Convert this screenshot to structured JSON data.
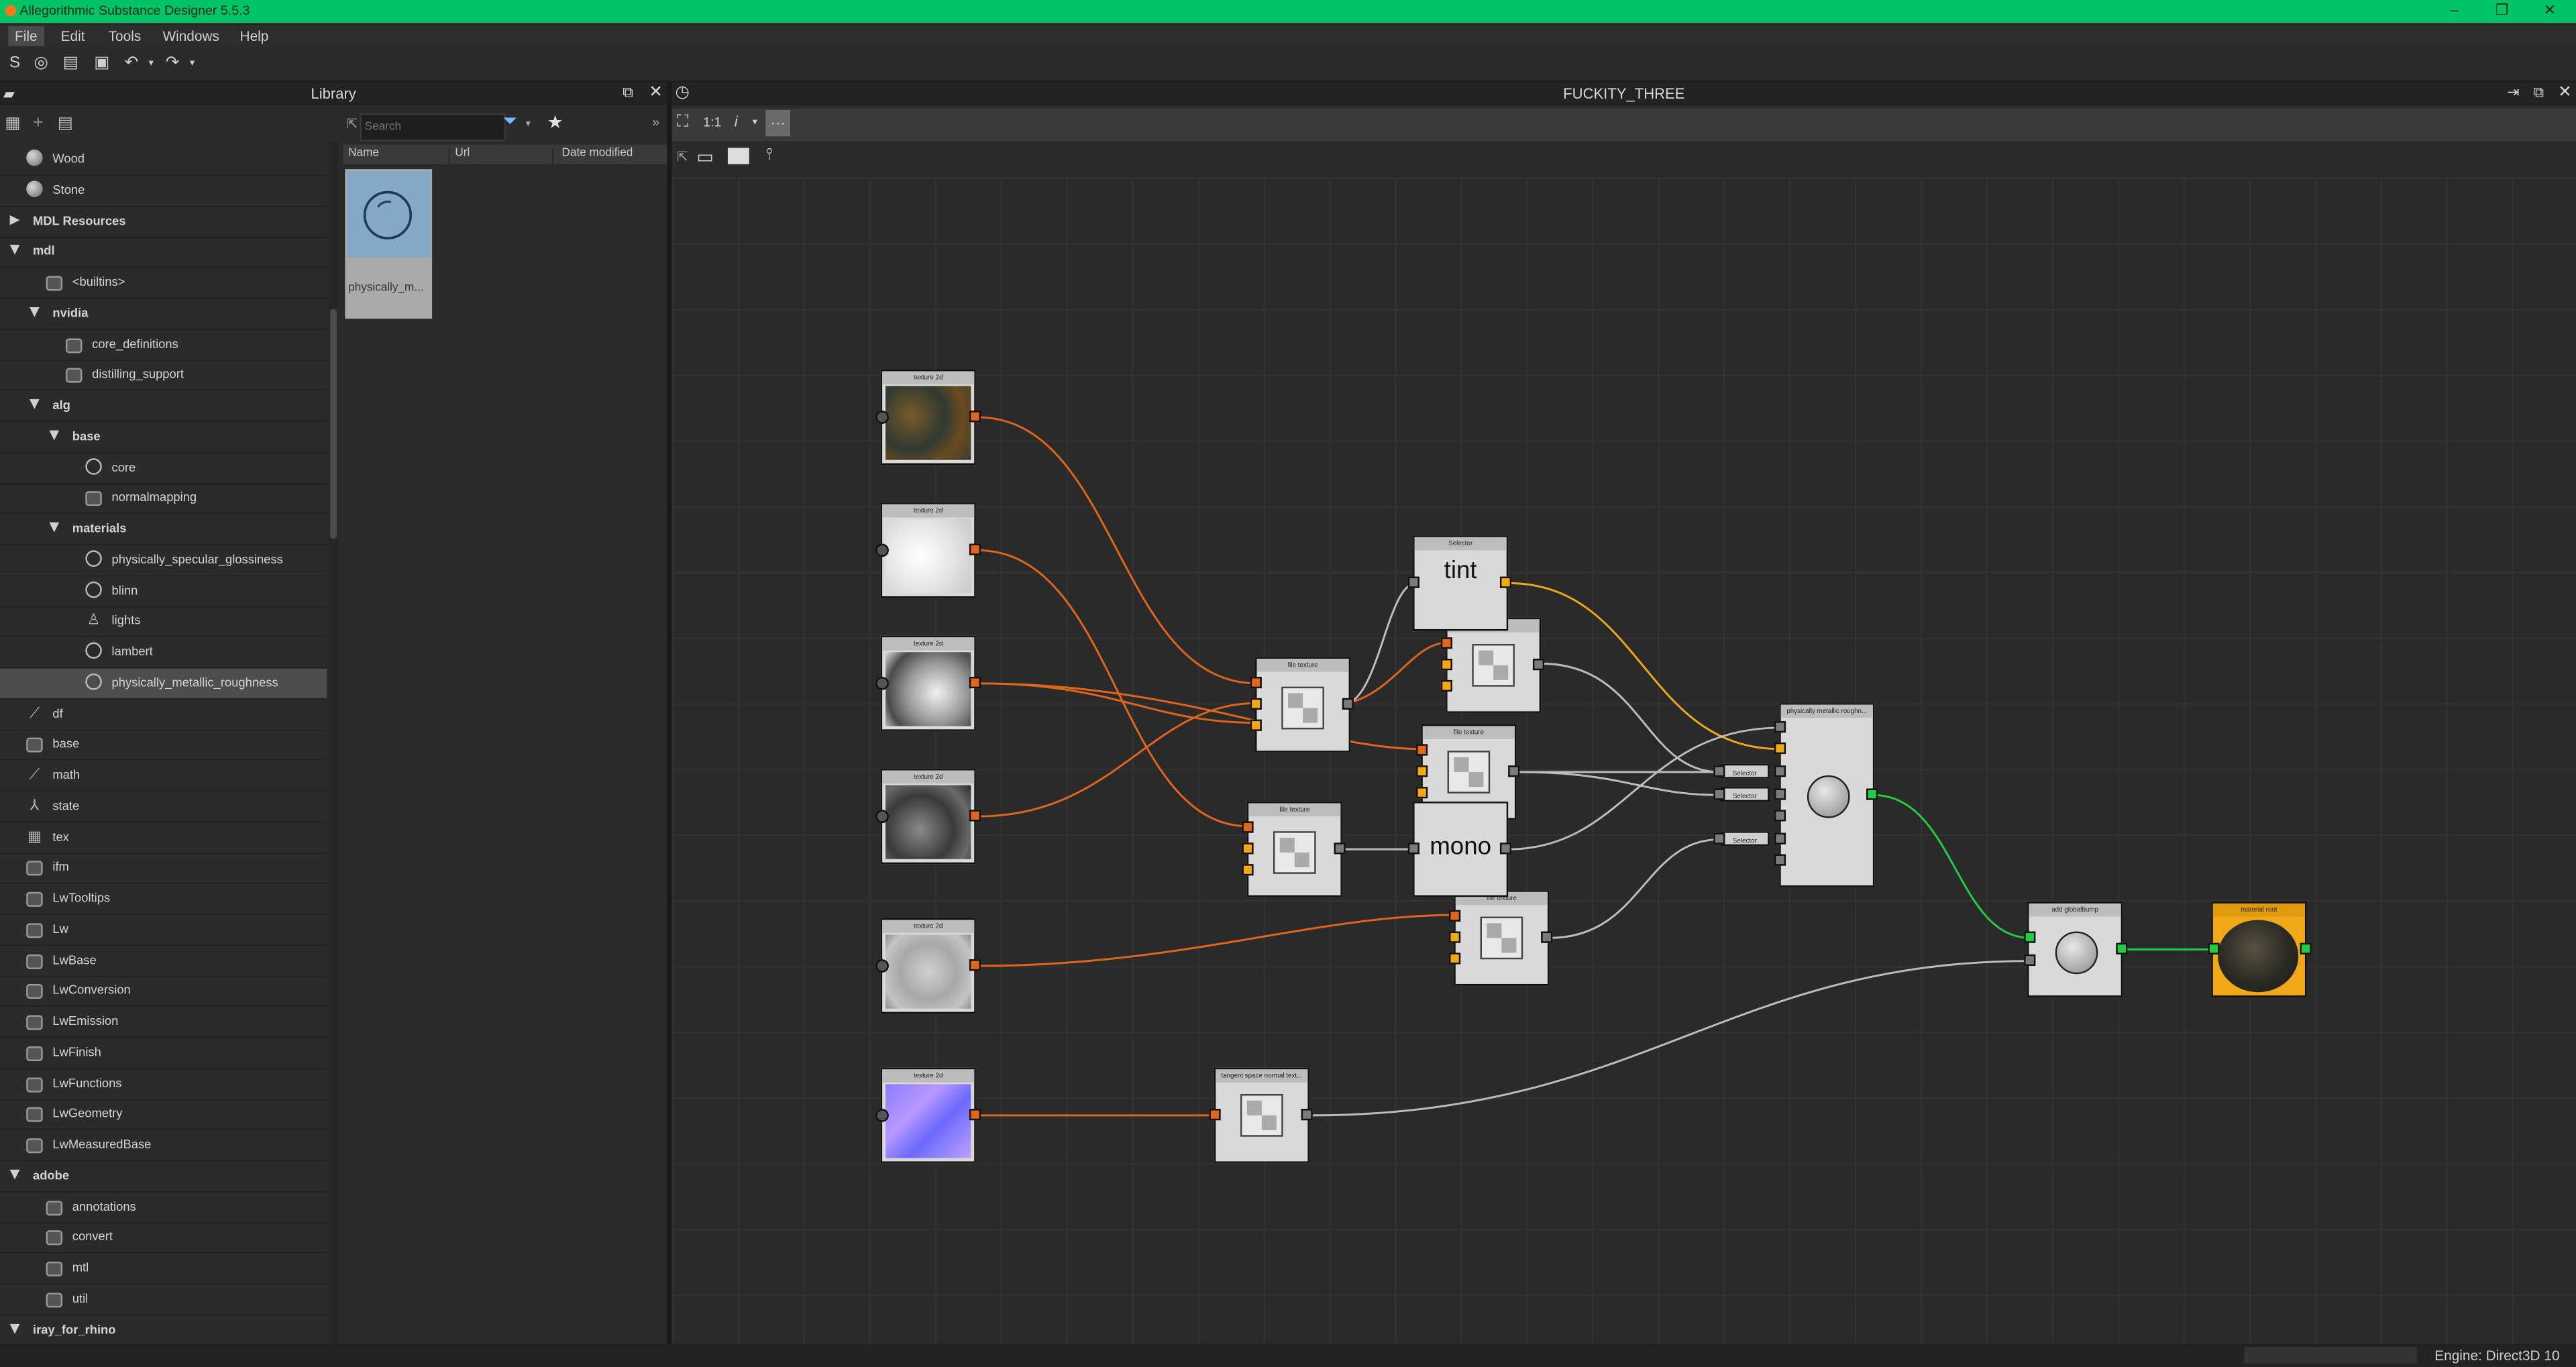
{
  "window": {
    "title": "Allegorithmic Substance Designer 5.5.3",
    "min": "–",
    "max": "❐",
    "close": "✕"
  },
  "menu": [
    "File",
    "Edit",
    "Tools",
    "Windows",
    "Help"
  ],
  "library": {
    "title": "Library",
    "search_placeholder": "Search",
    "columns": [
      "Name",
      "Url",
      "Date modified"
    ],
    "thumb_label": "physically_m...",
    "tree": [
      {
        "label": "Wood",
        "indent": 0,
        "icon": "ball"
      },
      {
        "label": "Stone",
        "indent": 0,
        "icon": "ball"
      },
      {
        "label": "MDL Resources",
        "indent": 0,
        "toggle": "right",
        "bold": true
      },
      {
        "label": "mdl",
        "indent": 0,
        "toggle": "down",
        "bold": true
      },
      {
        "label": "<builtins>",
        "indent": 1,
        "icon": "stack"
      },
      {
        "label": "nvidia",
        "indent": 1,
        "toggle": "down",
        "bold": true
      },
      {
        "label": "core_definitions",
        "indent": 2,
        "icon": "stack"
      },
      {
        "label": "distilling_support",
        "indent": 2,
        "icon": "stack"
      },
      {
        "label": "alg",
        "indent": 1,
        "toggle": "down",
        "bold": true
      },
      {
        "label": "base",
        "indent": 2,
        "toggle": "down",
        "bold": true
      },
      {
        "label": "core",
        "indent": 3,
        "icon": "radio"
      },
      {
        "label": "normalmapping",
        "indent": 3,
        "icon": "stack"
      },
      {
        "label": "materials",
        "indent": 2,
        "toggle": "down",
        "bold": true
      },
      {
        "label": "physically_specular_glossiness",
        "indent": 3,
        "icon": "circ"
      },
      {
        "label": "blinn",
        "indent": 3,
        "icon": "circ"
      },
      {
        "label": "lights",
        "indent": 3,
        "icon": "light"
      },
      {
        "label": "lambert",
        "indent": 3,
        "icon": "circ"
      },
      {
        "label": "physically_metallic_roughness",
        "indent": 3,
        "icon": "circ",
        "selected": true
      },
      {
        "label": "df",
        "indent": 0,
        "icon": "graph"
      },
      {
        "label": "base",
        "indent": 0,
        "icon": "stack"
      },
      {
        "label": "math",
        "indent": 0,
        "icon": "graph"
      },
      {
        "label": "state",
        "indent": 0,
        "icon": "axes"
      },
      {
        "label": "tex",
        "indent": 0,
        "icon": "grid"
      },
      {
        "label": "ifm",
        "indent": 0,
        "icon": "stack"
      },
      {
        "label": "LwTooltips",
        "indent": 0,
        "icon": "stack"
      },
      {
        "label": "Lw",
        "indent": 0,
        "icon": "stack"
      },
      {
        "label": "LwBase",
        "indent": 0,
        "icon": "stack"
      },
      {
        "label": "LwConversion",
        "indent": 0,
        "icon": "stack"
      },
      {
        "label": "LwEmission",
        "indent": 0,
        "icon": "stack"
      },
      {
        "label": "LwFinish",
        "indent": 0,
        "icon": "stack"
      },
      {
        "label": "LwFunctions",
        "indent": 0,
        "icon": "stack"
      },
      {
        "label": "LwGeometry",
        "indent": 0,
        "icon": "stack"
      },
      {
        "label": "LwMeasuredBase",
        "indent": 0,
        "icon": "stack"
      },
      {
        "label": "adobe",
        "indent": 0,
        "toggle": "down",
        "bold": true
      },
      {
        "label": "annotations",
        "indent": 1,
        "icon": "stack"
      },
      {
        "label": "convert",
        "indent": 1,
        "icon": "stack"
      },
      {
        "label": "mtl",
        "indent": 1,
        "icon": "stack"
      },
      {
        "label": "util",
        "indent": 1,
        "icon": "stack"
      },
      {
        "label": "iray_for_rhino",
        "indent": 0,
        "toggle": "down",
        "bold": true
      }
    ]
  },
  "graph": {
    "title": "FUCKITY_THREE",
    "zoom": "1:1",
    "info": "i",
    "nodes": {
      "tex1": "texture 2d",
      "tex2": "texture 2d",
      "tex3": "texture 2d",
      "tex4": "texture 2d",
      "tex5": "texture 2d",
      "tex6": "texture 2d",
      "file1": "file texture",
      "file2": "file texture",
      "file3": "file texture",
      "file4": "file texture",
      "file5": "file texture",
      "tangent": "tangent space normal text...",
      "selector_tint": "Selector",
      "tint": "tint",
      "mono": "mono",
      "sel1": "Selector",
      "sel2": "Selector",
      "sel3": "Selector",
      "pmr": "physically metallic roughn...",
      "glob": "add globalbump",
      "matroot": "material root"
    }
  },
  "status": {
    "engine": "Engine: Direct3D 10"
  },
  "colors": {
    "titlebar": "#00c466",
    "wire_orange": "#e0661c",
    "wire_yellow": "#f0a818",
    "wire_green": "#22cc44",
    "wire_gray": "#bdbdbd"
  }
}
